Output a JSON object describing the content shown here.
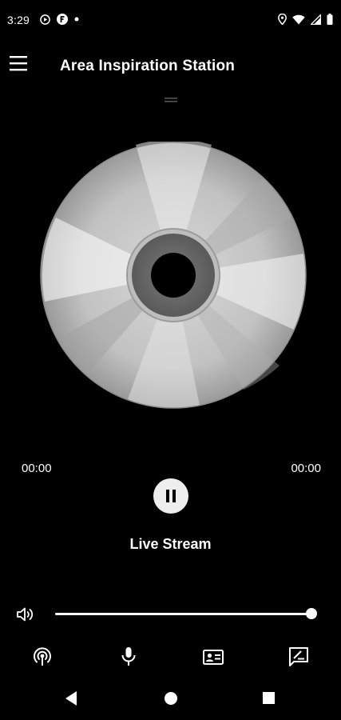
{
  "status_bar": {
    "time": "3:29",
    "icons": [
      "play-circle-icon",
      "f-circle-icon",
      "dot-icon",
      "location-icon",
      "wifi-icon",
      "signal-icon",
      "battery-icon"
    ]
  },
  "app_bar": {
    "title": "Area Inspiration Station",
    "menu_icon": "menu-icon"
  },
  "player": {
    "elapsed": "00:00",
    "duration": "00:00",
    "state": "playing",
    "play_pause_icon": "pause-icon",
    "track_title": "Live Stream",
    "volume": 1.0
  },
  "bottom_nav": {
    "items": [
      "podcast-icon",
      "microphone-icon",
      "contact-card-icon",
      "feedback-icon"
    ]
  },
  "system_nav": {
    "items": [
      "back-icon",
      "home-icon",
      "recents-icon"
    ]
  },
  "colors": {
    "background": "#000000",
    "foreground": "#ffffff",
    "pause_button": "#eeeeee"
  }
}
